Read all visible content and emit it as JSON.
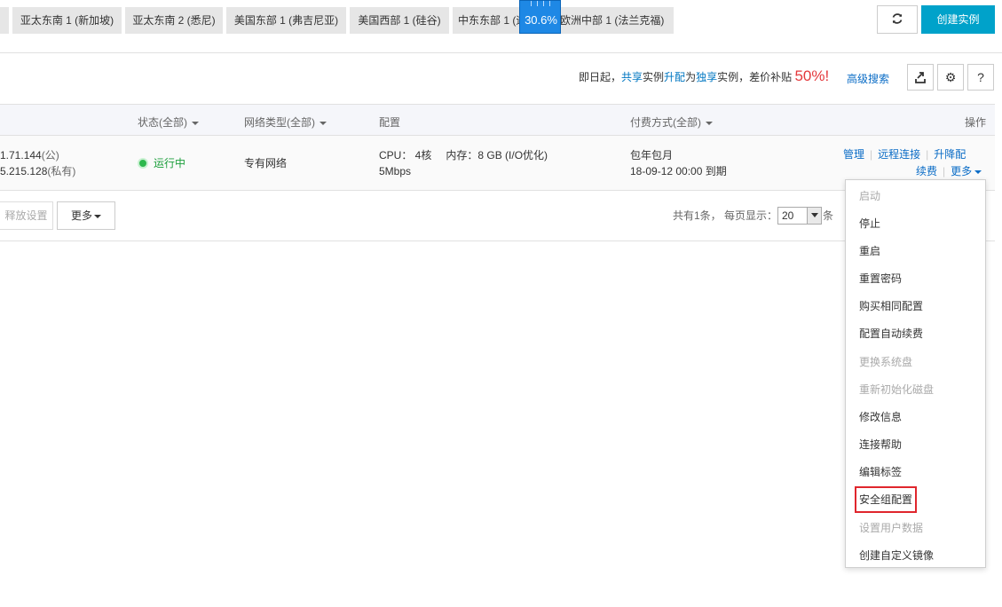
{
  "regions": [
    {
      "label": "亚太东南 1 (新加坡)"
    },
    {
      "label": "亚太东南 2 (悉尼)"
    },
    {
      "label": "美国东部 1 (弗吉尼亚)"
    },
    {
      "label": "美国西部 1 (硅谷)"
    },
    {
      "label": "中东东部 1 (迪拜)"
    },
    {
      "label": "欧洲中部 1 (法兰克福)"
    }
  ],
  "floating_badge": {
    "value": "30.6%"
  },
  "header": {
    "refresh_icon": "refresh-icon",
    "create_label": "创建实例"
  },
  "toolbar": {
    "promo_prefix": "即日起，",
    "promo_shared": "共享",
    "promo_mid1": "实例",
    "promo_upgrade": "升配",
    "promo_mid2": "为",
    "promo_exclusive": "独享",
    "promo_suffix": "实例，差价补贴 ",
    "promo_percent": "50%!",
    "advanced_search": "高级搜索",
    "icons": [
      "export-icon",
      "gear-icon",
      "help-icon"
    ],
    "help_label": "?"
  },
  "table": {
    "headers": {
      "status": "状态(全部)",
      "network": "网络类型(全部)",
      "config": "配置",
      "billing": "付费方式(全部)",
      "actions": "操作"
    },
    "row": {
      "ip_public": "1.71.144",
      "ip_public_tag": "(公)",
      "ip_private": "5.215.128",
      "ip_private_tag": "(私有)",
      "status": "运行中",
      "network": "专有网络",
      "cpu": "CPU： 4核",
      "memory": "内存：8 GB (I/O优化)",
      "bandwidth": "5Mbps",
      "billing_type": "包年包月",
      "expiry": "18-09-12 00:00 到期",
      "actions": {
        "manage": "管理",
        "remote": "远程连接",
        "upgrade": "升降配",
        "renew": "续费",
        "more": "更多"
      }
    }
  },
  "footer": {
    "release_label": "释放设置",
    "more_label": "更多",
    "total_text": "共有1条， 每页显示：",
    "page_size": "20",
    "page_suffix": "条"
  },
  "more_menu": [
    {
      "label": "启动",
      "disabled": true
    },
    {
      "label": "停止",
      "disabled": false
    },
    {
      "label": "重启",
      "disabled": false
    },
    {
      "label": "重置密码",
      "disabled": false
    },
    {
      "label": "购买相同配置",
      "disabled": false
    },
    {
      "label": "配置自动续费",
      "disabled": false
    },
    {
      "label": "更换系统盘",
      "disabled": true
    },
    {
      "label": "重新初始化磁盘",
      "disabled": true
    },
    {
      "label": "修改信息",
      "disabled": false
    },
    {
      "label": "连接帮助",
      "disabled": false
    },
    {
      "label": "编辑标签",
      "disabled": false
    },
    {
      "label": "安全组配置",
      "disabled": false,
      "highlighted": true
    },
    {
      "label": "设置用户数据",
      "disabled": true
    },
    {
      "label": "创建自定义镜像",
      "disabled": false
    }
  ],
  "colors": {
    "accent": "#00a2ca",
    "link": "#0a6cc6",
    "running": "#2db84d",
    "highlight_box": "#e0262d",
    "promo_red": "#e4393c"
  }
}
